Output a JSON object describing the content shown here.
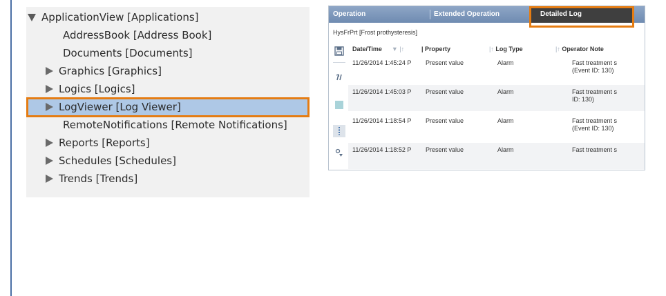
{
  "tree": {
    "root": {
      "label": "ApplicationView [Applications]",
      "expanded": true
    },
    "items": [
      {
        "label": "AddressBook [Address Book]",
        "expandable": false
      },
      {
        "label": "Documents [Documents]",
        "expandable": false
      },
      {
        "label": "Graphics [Graphics]",
        "expandable": true
      },
      {
        "label": "Logics [Logics]",
        "expandable": true
      },
      {
        "label": "LogViewer [Log Viewer]",
        "expandable": true,
        "selected": true
      },
      {
        "label": "RemoteNotifications [Remote Notifications]",
        "expandable": false
      },
      {
        "label": "Reports [Reports]",
        "expandable": true
      },
      {
        "label": "Schedules [Schedules]",
        "expandable": true
      },
      {
        "label": "Trends [Trends]",
        "expandable": true
      }
    ]
  },
  "log_window": {
    "tabs": [
      {
        "label": "Operation",
        "active": false
      },
      {
        "label": "Extended Operation",
        "active": false
      },
      {
        "label": "Detailed Log",
        "active": true
      }
    ],
    "path": "HysFrPrt [Frost prothysteresis]",
    "toolbar_icons": [
      "save-icon",
      "refresh-icon",
      "stop-icon",
      "columns-icon",
      "filter-icon"
    ],
    "columns": [
      "Date/Time",
      "Property",
      "Log Type",
      "Operator Note"
    ],
    "rows": [
      {
        "datetime": "11/26/2014 1:45:24 P",
        "property": "Present value",
        "log_type": "Alarm",
        "note": "Fast treatment s (Event ID: 130)"
      },
      {
        "datetime": "11/26/2014 1:45:03 P",
        "property": "Present value",
        "log_type": "Alarm",
        "note": "Fast treatment s ID: 130)"
      },
      {
        "datetime": "11/26/2014 1:18:54 P",
        "property": "Present value",
        "log_type": "Alarm",
        "note": "Fast treatment s (Event ID: 130)"
      },
      {
        "datetime": "11/26/2014 1:18:52 P",
        "property": "Present value",
        "log_type": "Alarm",
        "note": "Fast treatment s"
      }
    ]
  },
  "colors": {
    "highlight": "#e57c12",
    "selection": "#aec8e6",
    "tabbar": "#7a94b8",
    "active_tab": "#3f3f3f"
  }
}
